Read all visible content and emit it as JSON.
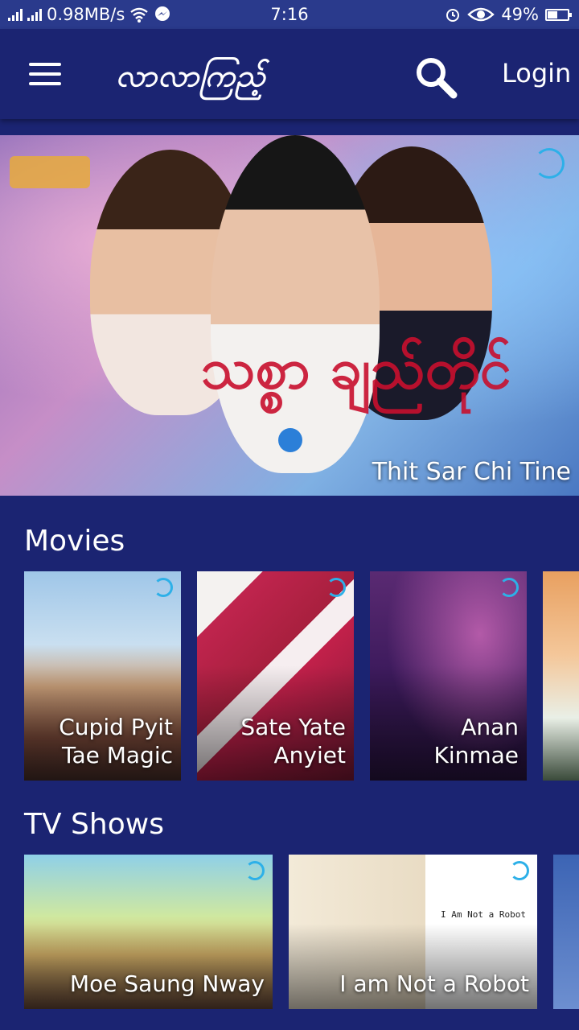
{
  "status_bar": {
    "speed": "0.98MB/s",
    "time": "7:16",
    "battery": "49%",
    "battery_level": 0.49
  },
  "header": {
    "brand": "လာလာကြည့်",
    "login_label": "Login"
  },
  "hero": {
    "caption": "Thit Sar Chi Tine",
    "art_title": "သစ္စာ ချည်တိုင်"
  },
  "movies": {
    "title": "Movies",
    "items": [
      {
        "title": "Cupid Pyit Tae Magic"
      },
      {
        "title": "Sate Yate Anyiet"
      },
      {
        "title": "Anan Kinmae"
      }
    ]
  },
  "tv_shows": {
    "title": "TV Shows",
    "items": [
      {
        "title": "Moe Saung Nway"
      },
      {
        "title": "I am Not a Robot",
        "poster_text": "I Am Not a Robot"
      }
    ]
  },
  "icons": {
    "menu": "hamburger-menu-icon",
    "search": "search-icon",
    "channel": "channel-logo-icon",
    "wifi": "wifi-icon",
    "messenger": "messenger-icon",
    "alarm": "alarm-icon",
    "eye": "eye-icon",
    "battery": "battery-icon"
  },
  "colors": {
    "background": "#1b2472",
    "status_bar": "#2a3a8c",
    "accent": "#2db0e8"
  }
}
